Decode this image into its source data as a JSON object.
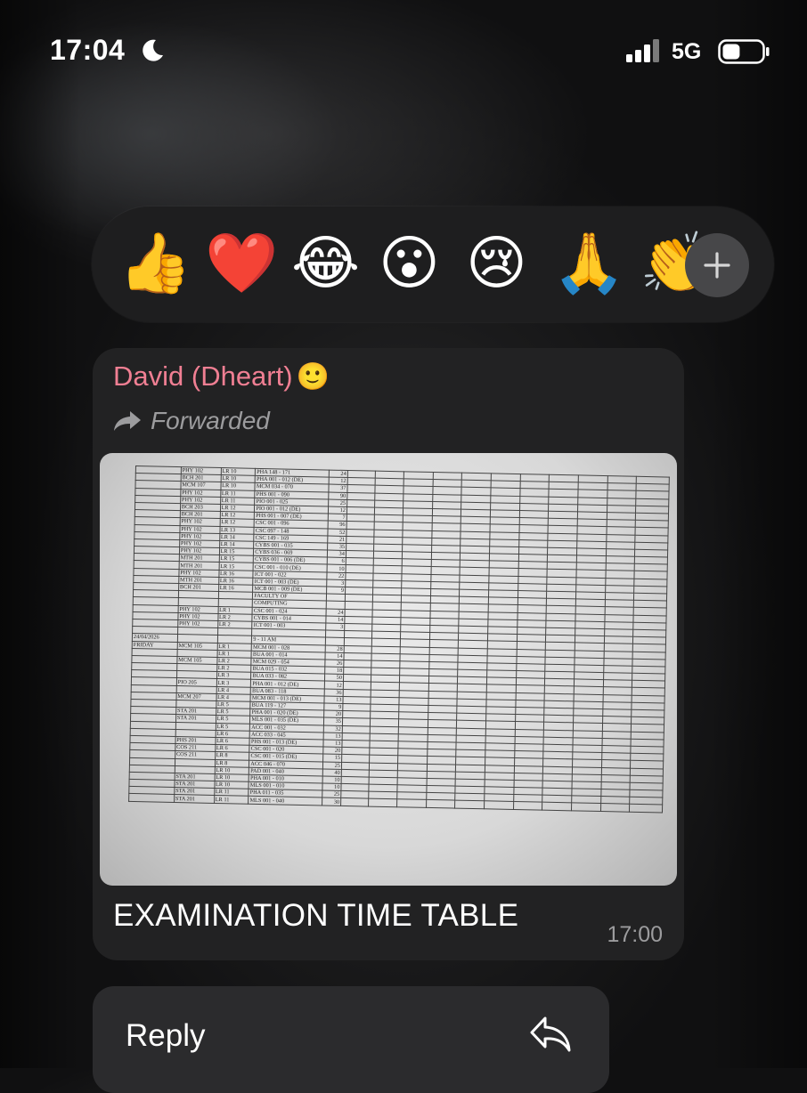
{
  "status_bar": {
    "time": "17:04",
    "focus_icon": "moon-icon",
    "network": "5G",
    "signal_bars": 4,
    "battery_level": 0.45
  },
  "reactions": {
    "items": [
      {
        "name": "thumbs-up",
        "glyph": "👍"
      },
      {
        "name": "red-heart",
        "glyph": "❤️"
      },
      {
        "name": "tears-of-joy",
        "glyph": "😂"
      },
      {
        "name": "surprised",
        "glyph": "😮"
      },
      {
        "name": "crying",
        "glyph": "😢"
      },
      {
        "name": "folded-hands",
        "glyph": "🙏"
      },
      {
        "name": "clapping",
        "glyph": "👏"
      }
    ],
    "more_icon": "plus-icon"
  },
  "message": {
    "sender": "David (Dheart)",
    "sender_emoji": "🙂",
    "sender_color": "#f07f93",
    "forwarded_label": "Forwarded",
    "caption": "EXAMINATION TIME TABLE",
    "time": "17:00",
    "photo": {
      "rows": [
        [
          "",
          "PHY 102",
          "LR 10",
          "PHA 148 - 171",
          "24"
        ],
        [
          "",
          "BCH 201",
          "LR 10",
          "PHA 001 - 012 (DE)",
          "12"
        ],
        [
          "",
          "MCM 107",
          "LR 10",
          "MCM 034 - 070",
          "37"
        ],
        [
          "",
          "PHY 102",
          "LR 11",
          "PHS 001 - 090",
          "90"
        ],
        [
          "",
          "PHY 102",
          "LR 11",
          "PIO 001 - 025",
          "25"
        ],
        [
          "",
          "BCH 203",
          "LR 12",
          "PIO 001 - 012 (DE)",
          "12"
        ],
        [
          "",
          "BCH 201",
          "LR 12",
          "PHS 001 - 007 (DE)",
          "7"
        ],
        [
          "",
          "PHY 102",
          "LR 12",
          "CSC 001 - 096",
          "96"
        ],
        [
          "",
          "PHY 102",
          "LR 13",
          "CSC 097 - 148",
          "52"
        ],
        [
          "",
          "PHY 102",
          "LR 14",
          "CSC 149 - 169",
          "21"
        ],
        [
          "",
          "PHY 102",
          "LR 14",
          "CYBS 001 - 035",
          "35"
        ],
        [
          "",
          "PHY 102",
          "LR 15",
          "CYBS 036 - 069",
          "34"
        ],
        [
          "",
          "MTH 201",
          "LR 15",
          "CYBS 001 - 006 (DE)",
          "6"
        ],
        [
          "",
          "MTH 201",
          "LR 15",
          "CSC 001 - 010 (DE)",
          "10"
        ],
        [
          "",
          "PHY 102",
          "LR 16",
          "ICT 001 - 022",
          "22"
        ],
        [
          "",
          "MTH 201",
          "LR 16",
          "ICT 001 - 003 (DE)",
          "3"
        ],
        [
          "",
          "BCH 201",
          "LR 16",
          "MCB 001 - 009 (DE)",
          "9"
        ],
        [
          "",
          "",
          "",
          "FACULTY OF",
          ""
        ],
        [
          "",
          "",
          "",
          "COMPUTING",
          ""
        ],
        [
          "",
          "PHY 102",
          "LR 1",
          "CSC 001 - 024",
          "24"
        ],
        [
          "",
          "PHY 102",
          "LR 2",
          "CYBS 001 - 014",
          "14"
        ],
        [
          "",
          "PHY 102",
          "LR 2",
          "ICT 001 - 003",
          "3"
        ],
        [
          "",
          "",
          "",
          "",
          ""
        ],
        [
          "24/04/2026",
          "",
          "",
          "9 - 11 AM",
          ""
        ],
        [
          "FRIDAY",
          "MCM 105",
          "LR 1",
          "MCM 001 - 028",
          "28"
        ],
        [
          "",
          "",
          "LR 1",
          "BUA 001 - 014",
          "14"
        ],
        [
          "",
          "MCM 105",
          "LR 2",
          "MCM 029 - 054",
          "26"
        ],
        [
          "",
          "",
          "LR 2",
          "BUA 015 - 032",
          "18"
        ],
        [
          "",
          "",
          "LR 3",
          "BUA 033 - 082",
          "50"
        ],
        [
          "",
          "PIO 205",
          "LR 3",
          "PHA 001 - 012 (DE)",
          "12"
        ],
        [
          "",
          "",
          "LR 4",
          "BUA 083 - 118",
          "36"
        ],
        [
          "",
          "MCM 207",
          "LR 4",
          "MCM 001 - 013 (DE)",
          "13"
        ],
        [
          "",
          "",
          "LR 5",
          "BUA 119 - 127",
          "9"
        ],
        [
          "",
          "STA 201",
          "LR 5",
          "PHA 001 - 020 (DE)",
          "20"
        ],
        [
          "",
          "STA 201",
          "LR 5",
          "MLS 001 - 035 (DE)",
          "35"
        ],
        [
          "",
          "",
          "LR 5",
          "ACC 001 - 032",
          "32"
        ],
        [
          "",
          "",
          "LR 6",
          "ACC 033 - 045",
          "13"
        ],
        [
          "",
          "PHS 201",
          "LR 6",
          "PHS 001 - 013 (DE)",
          "13"
        ],
        [
          "",
          "COS 211",
          "LR 6",
          "CSC 001 - 020",
          "20"
        ],
        [
          "",
          "COS 211",
          "LR 8",
          "CSC 001 - 015 (DE)",
          "15"
        ],
        [
          "",
          "",
          "LR 8",
          "ACC 046 - 070",
          "25"
        ],
        [
          "",
          "",
          "LR 10",
          "PAD 001 - 040",
          "40"
        ],
        [
          "",
          "STA 201",
          "LR 10",
          "PHA 001 - 010",
          "10"
        ],
        [
          "",
          "STA 201",
          "LR 10",
          "MLS 001 - 010",
          "10"
        ],
        [
          "",
          "STA 201",
          "LR 11",
          "PHA 011 - 035",
          "25"
        ],
        [
          "",
          "STA 201",
          "LR 11",
          "MLS 001 - 040",
          "30"
        ]
      ]
    }
  },
  "actions": {
    "reply_label": "Reply",
    "reply_icon": "reply-arrow-icon"
  }
}
